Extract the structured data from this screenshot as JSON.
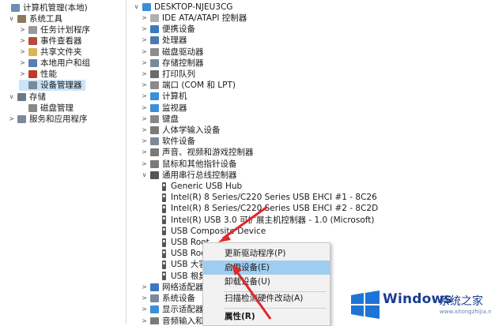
{
  "left_tree": {
    "items": [
      {
        "label": "计算机管理(本地)",
        "icon": "computer-management-icon",
        "toggle": "",
        "color": "#6b8fb5"
      },
      {
        "label": "系统工具",
        "icon": "tools-icon",
        "toggle": "∨",
        "color": "#8a7a5c"
      },
      {
        "label": "任务计划程序",
        "icon": "clock-icon",
        "toggle": ">",
        "color": "#9a9a9a"
      },
      {
        "label": "事件查看器",
        "icon": "event-viewer-icon",
        "toggle": ">",
        "color": "#b84a3a"
      },
      {
        "label": "共享文件夹",
        "icon": "shared-folder-icon",
        "toggle": ">",
        "color": "#d9b55a"
      },
      {
        "label": "本地用户和组",
        "icon": "users-icon",
        "toggle": ">",
        "color": "#5a7fb0"
      },
      {
        "label": "性能",
        "icon": "performance-icon",
        "toggle": ">",
        "color": "#c0392b"
      },
      {
        "label": "设备管理器",
        "icon": "device-manager-icon",
        "toggle": "",
        "color": "#7a8a99"
      },
      {
        "label": "存储",
        "icon": "storage-icon",
        "toggle": "∨",
        "color": "#6b7a88"
      },
      {
        "label": "磁盘管理",
        "icon": "disk-icon",
        "toggle": "",
        "color": "#888888"
      },
      {
        "label": "服务和应用程序",
        "icon": "services-icon",
        "toggle": ">",
        "color": "#7a8a99"
      }
    ]
  },
  "device_tree": {
    "root": {
      "label": "DESKTOP-NJEU3CG",
      "icon": "computer-icon"
    },
    "categories": [
      {
        "label": "IDE ATA/ATAPI 控制器",
        "icon": "ide-icon",
        "color": "#b0b0b0"
      },
      {
        "label": "便携设备",
        "icon": "portable-device-icon",
        "color": "#3a78c2"
      },
      {
        "label": "处理器",
        "icon": "processor-icon",
        "color": "#4a7ab0"
      },
      {
        "label": "磁盘驱动器",
        "icon": "disk-drive-icon",
        "color": "#8c8c8c"
      },
      {
        "label": "存储控制器",
        "icon": "storage-controller-icon",
        "color": "#7a8a99"
      },
      {
        "label": "打印队列",
        "icon": "printer-icon",
        "color": "#6a6a6a"
      },
      {
        "label": "端口 (COM 和 LPT)",
        "icon": "port-icon",
        "color": "#8a8a8a"
      },
      {
        "label": "计算机",
        "icon": "computer-icon",
        "color": "#3a8fd6"
      },
      {
        "label": "监视器",
        "icon": "monitor-icon",
        "color": "#3a8fd6"
      },
      {
        "label": "键盘",
        "icon": "keyboard-icon",
        "color": "#888888"
      },
      {
        "label": "人体学输入设备",
        "icon": "hid-icon",
        "color": "#7a7a7a"
      },
      {
        "label": "软件设备",
        "icon": "software-device-icon",
        "color": "#7a8a99"
      },
      {
        "label": "声音、视频和游戏控制器",
        "icon": "sound-icon",
        "color": "#7a7a7a"
      },
      {
        "label": "鼠标和其他指针设备",
        "icon": "mouse-icon",
        "color": "#7a7a7a"
      },
      {
        "label": "通用串行总线控制器",
        "icon": "usb-controller-icon",
        "color": "#555555"
      }
    ],
    "usb_children": [
      "Generic USB Hub",
      "Intel(R) 8 Series/C220 Series USB EHCI #1 - 8C26",
      "Intel(R) 8 Series/C220 Series USB EHCI #2 - 8C2D",
      "Intel(R) USB 3.0 可扩展主机控制器 - 1.0 (Microsoft)",
      "USB Composite Device",
      "USB Root",
      "USB Roo",
      "USB 大容",
      "USB 根集"
    ],
    "after_categories": [
      {
        "label": "网络适配器",
        "icon": "network-icon",
        "color": "#3a78c2"
      },
      {
        "label": "系统设备",
        "icon": "system-device-icon",
        "color": "#7a8a99"
      },
      {
        "label": "显示适配器",
        "icon": "display-adapter-icon",
        "color": "#3a8fd6"
      },
      {
        "label": "音频输入和输",
        "icon": "audio-icon",
        "color": "#7a7a7a"
      }
    ]
  },
  "context_menu": {
    "items": [
      {
        "label": "更新驱动程序(P)",
        "highlight": false
      },
      {
        "label": "启用设备(E)",
        "highlight": true
      },
      {
        "label": "卸载设备(U)",
        "highlight": false
      },
      {
        "label": "扫描检测硬件改动(A)",
        "highlight": false
      },
      {
        "label": "属性(R)",
        "highlight": false
      }
    ]
  },
  "watermark": {
    "brand": "Windows",
    "tagline": "系统之家",
    "url": "www.xitongzhijia.net",
    "logo_colors": [
      "#1e73d6",
      "#1e73d6",
      "#1e73d6",
      "#1e73d6"
    ]
  },
  "annotation": {
    "arrow_color": "#e0282a"
  }
}
